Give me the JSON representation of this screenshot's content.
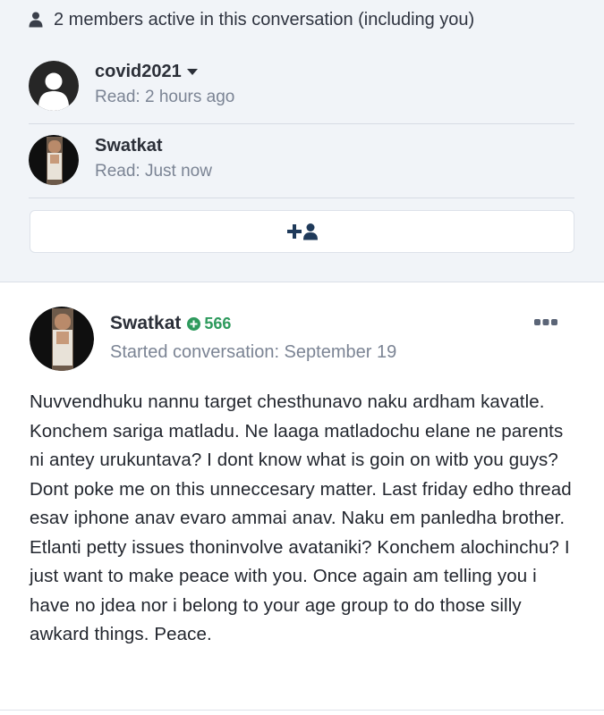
{
  "members": {
    "header": "2 members active in this conversation (including you)",
    "list": [
      {
        "name": "covid2021",
        "read": "Read: 2 hours ago",
        "has_menu": true
      },
      {
        "name": "Swatkat",
        "read": "Read: Just now",
        "has_menu": false
      }
    ]
  },
  "invite": {
    "icon": "add-user-icon"
  },
  "message": {
    "author": "Swatkat",
    "reputation": "566",
    "started": "Started conversation: September 19",
    "body": "Nuvvendhuku nannu target chesthunavo naku ardham kavatle. Konchem sariga matladu. Ne laaga matladochu elane ne parents ni antey urukuntava? I dont know what is goin on witb you guys? Dont poke me on this unneccesary matter. Last friday edho thread esav iphone anav evaro ammai anav. Naku em panledha brother. Etlanti petty issues thoninvolve avataniki? Konchem alochinchu? I just want to make peace with you. Once again am telling you i have no jdea nor i belong to your age group to do those silly awkard things. Peace."
  },
  "colors": {
    "page_bg": "#f1f4f8",
    "card_bg": "#ffffff",
    "muted_text": "#7b8494",
    "reputation_green": "#2e9a5d",
    "icon_navy": "#1f3a5a"
  }
}
